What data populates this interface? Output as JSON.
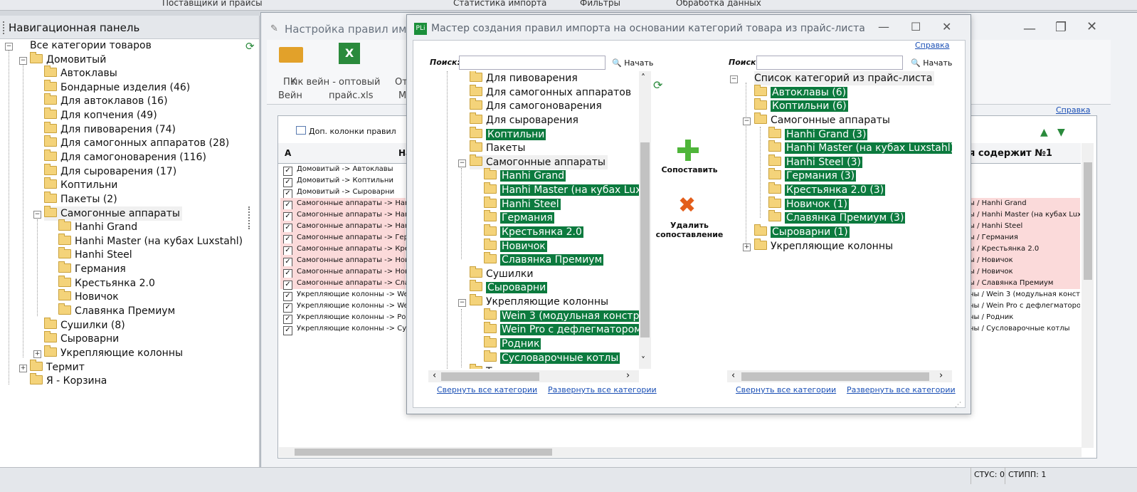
{
  "topmenu": [
    "Поставщики и прайсы",
    "Статистика импорта",
    "Фильтры",
    "Обработка данных"
  ],
  "nav": {
    "title": "Навигационная панель",
    "items": [
      "Все категории товаров",
      "Домовитый",
      "Автоклавы",
      "Бондарные изделия (46)",
      "Для автоклавов (16)",
      "Для копчения (49)",
      "Для пивоварения (74)",
      "Для самогонных аппаратов (28)",
      "Для самогоноварения (116)",
      "Для сыроварения (17)",
      "Коптильни",
      "Пакеты (2)",
      "Самогонные аппараты",
      "Hanhi Grand",
      "Hanhi Master (на кубах Luxstahl)",
      "Hanhi Steel",
      "Германия",
      "Крестьянка 2.0",
      "Новичок",
      "Славянка Премиум",
      "Сушилки (8)",
      "Сыроварни",
      "Укрепляющие колонны",
      "Термит",
      "Я - Корзина"
    ]
  },
  "bgwin": {
    "title": "Настройка правил импо",
    "ribbon": {
      "b1": "ПК",
      "b1b": "Вейн",
      "b2": "пк вейн - оптовый",
      "b2b": "прайс.xls",
      "b3": "От",
      "b3b": "М"
    },
    "help": "Справка",
    "extra_cols": "Доп. колонки правил",
    "col_a": "A",
    "col_na": "На",
    "col_right": "я содержит №1",
    "rows": [
      "Домовитый -> Автоклавы",
      "Домовитый -> Коптильни",
      "Домовитый -> Сыроварни",
      "Самогонные аппараты -> Hanh",
      "Самогонные аппараты -> Hanh",
      "Самогонные аппараты -> Hanh",
      "Самогонные аппараты -> Герм",
      "Самогонные аппараты -> Крес",
      "Самогонные аппараты -> Нови",
      "Самогонные аппараты -> Нови",
      "Самогонные аппараты -> Слав",
      "Укрепляющие колонны -> Wein",
      "Укрепляющие колонны -> Wein",
      "Укрепляющие колонны -> Родн",
      "Укрепляющие колонны -> Сусл"
    ],
    "right_rows": [
      "ы / Hanhi Grand",
      "ы / Hanhi Master (на кубах Luxst",
      "ы / Hanhi Steel",
      "ы / Германия",
      "ы / Крестьянка 2.0",
      "ы / Новичок",
      "ы / Новичок",
      "ы / Славянка Премиум",
      "ны / Wein 3 (модульная констру",
      "ны / Wein Pro с дефлегматором",
      "ны / Родник",
      "ны / Сусловарочные котлы"
    ]
  },
  "dialog": {
    "logo": "PLi",
    "title": "Мастер создания правил импорта на основании категорий товара из прайс-листа",
    "help": "Справка",
    "search_label": "Поиск:",
    "start": "Начать",
    "left_tree": [
      "Для пивоварения",
      "Для самогонных аппаратов",
      "Для самогоноварения",
      "Для сыроварения",
      "Коптильни",
      "Пакеты",
      "Самогонные аппараты",
      "Hanhi Grand",
      "Hanhi Master (на кубах Luxst",
      "Hanhi Steel",
      "Германия",
      "Крестьянка 2.0",
      "Новичок",
      "Славянка Премиум",
      "Сушилки",
      "Сыроварни",
      "Укрепляющие колонны",
      "Wein 3 (модульная конструк",
      "Wein Pro с дефлегматором (",
      "Родник",
      "Сусловарочные котлы",
      "Т"
    ],
    "right_tree": [
      "Список категорий из прайс-листа",
      "Автоклавы (6)",
      "Коптильни (6)",
      "Самогонные аппараты",
      "Hanhi Grand (3)",
      "Hanhi Master (на кубах Luxstahl) (3",
      "Hanhi Steel (3)",
      "Германия (3)",
      "Крестьянка 2.0 (3)",
      "Новичок (1)",
      "Славянка Премиум (3)",
      "Сыроварни (1)",
      "Укрепляющие колонны"
    ],
    "match": "Сопоставить",
    "unmatch1": "Удалить",
    "unmatch2": "сопоставление",
    "collapse": "Свернуть все категории",
    "expand": "Развернуть все категории"
  },
  "status": {
    "s1": "СТУС: 0",
    "s2": "СТИПП: 1"
  },
  "colors": {
    "highlight": "#0c7a3e",
    "pink": "#fbdada"
  }
}
